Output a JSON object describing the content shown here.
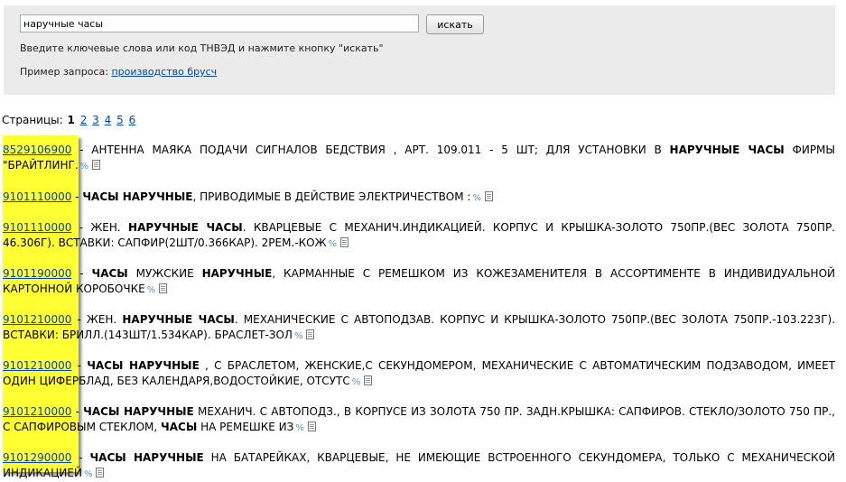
{
  "search": {
    "value": "наручные часы",
    "button_label": "искать",
    "hint": "Введите ключевые слова или код ТНВЭД и нажмите кнопку \"искать\"",
    "example_label": "Пример запроса:",
    "example_link": "производство брусч"
  },
  "pager": {
    "label": "Страницы:",
    "current": "1",
    "pages": [
      "2",
      "3",
      "4",
      "5",
      "6"
    ]
  },
  "results": [
    {
      "code": "8529106900",
      "segments": [
        {
          "t": " - АНТЕННА МАЯКА ПОДАЧИ СИГНАЛОВ БЕДСТВИЯ , АРТ. 109.011 - 5 ШТ; ДЛЯ УСТАНОВКИ В ",
          "b": false
        },
        {
          "t": "НАРУЧНЫЕ ЧАСЫ",
          "b": true
        },
        {
          "t": " ФИРМЫ \"БРАЙТЛИНГ.",
          "b": false
        }
      ]
    },
    {
      "code": "9101110000",
      "segments": [
        {
          "t": " - ",
          "b": false
        },
        {
          "t": "ЧАСЫ НАРУЧНЫЕ",
          "b": true
        },
        {
          "t": ", ПРИВОДИМЫЕ В ДЕЙСТВИЕ ЭЛЕКТРИЧЕСТВОМ :",
          "b": false
        }
      ]
    },
    {
      "code": "9101110000",
      "segments": [
        {
          "t": " - ЖЕН. ",
          "b": false
        },
        {
          "t": "НАРУЧНЫЕ ЧАСЫ",
          "b": true
        },
        {
          "t": ". КВАРЦЕВЫЕ С МЕХАНИЧ.ИНДИКАЦИЕЙ. КОРПУС И КРЫШКА-ЗОЛОТО 750ПР.(ВЕС ЗОЛОТА 750ПР. 46.306Г). ВСТАВКИ: САПФИР(2ШТ/0.366КАР). 2РЕМ.-КОЖ",
          "b": false
        }
      ]
    },
    {
      "code": "9101190000",
      "segments": [
        {
          "t": " - ",
          "b": false
        },
        {
          "t": "ЧАСЫ",
          "b": true
        },
        {
          "t": " МУЖСКИЕ ",
          "b": false
        },
        {
          "t": "НАРУЧНЫЕ",
          "b": true
        },
        {
          "t": ", КАРМАННЫЕ С РЕМЕШКОМ ИЗ КОЖЕЗАМЕНИТЕЛЯ В АССОРТИМЕНТЕ В ИНДИВИДУАЛЬНОЙ КАРТОННОЙ КОРОБОЧКЕ",
          "b": false
        }
      ]
    },
    {
      "code": "9101210000",
      "segments": [
        {
          "t": " - ЖЕН. ",
          "b": false
        },
        {
          "t": "НАРУЧНЫЕ ЧАСЫ",
          "b": true
        },
        {
          "t": ". МЕХАНИЧЕСКИЕ С АВТОПОДЗАВ. КОРПУС И КРЫШКА-ЗОЛОТО 750ПР.(ВЕС ЗОЛОТА 750ПР.-103.223Г). ВСТАВКИ: БРИЛЛ.(143ШТ/1.534КАР). БРАСЛЕТ-ЗОЛ",
          "b": false
        }
      ]
    },
    {
      "code": "9101210000",
      "segments": [
        {
          "t": " - ",
          "b": false
        },
        {
          "t": "ЧАСЫ НАРУЧНЫЕ",
          "b": true
        },
        {
          "t": " , С БРАСЛЕТОМ, ЖЕНСКИЕ,С СЕКУНДОМЕРОМ, МЕХАНИЧЕСКИЕ С АВТОМАТИЧЕСКИМ ПОДЗАВОДОМ, ИМЕЕТ ОДИН ЦИФЕРБЛАД, БЕЗ КАЛЕНДАРЯ,ВОДОСТОЙКИЕ, ОТСУТС",
          "b": false
        }
      ]
    },
    {
      "code": "9101210000",
      "segments": [
        {
          "t": " - ",
          "b": false
        },
        {
          "t": "ЧАСЫ НАРУЧНЫЕ",
          "b": true
        },
        {
          "t": " МЕХАНИЧ. С АВТОПОДЗ., В КОРПУСЕ ИЗ ЗОЛОТА 750 ПР. ЗАДН.КРЫШКА: САПФИРОВ. СТЕКЛО/ЗОЛОТО 750 ПР., С САПФИРОВЫМ СТЕКЛОМ, ",
          "b": false
        },
        {
          "t": "ЧАСЫ",
          "b": true
        },
        {
          "t": " НА РЕМЕШКЕ ИЗ",
          "b": false
        }
      ]
    },
    {
      "code": "9101290000",
      "segments": [
        {
          "t": " - ",
          "b": false
        },
        {
          "t": "ЧАСЫ НАРУЧНЫЕ",
          "b": true
        },
        {
          "t": " НА БАТАРЕЙКАХ, КВАРЦЕВЫЕ, НЕ ИМЕЮЩИЕ ВСТРОЕННОГО СЕКУНДОМЕРА, ТОЛЬКО С МЕХАНИЧЕСКОЙ ИНДИКАЦИЕЙ",
          "b": false
        }
      ]
    }
  ],
  "marker_symbol": "%",
  "icons": {
    "doc": "document-icon"
  },
  "colors": {
    "highlight": "#ffff33",
    "link": "#0645ad",
    "panel": "#ebebeb"
  }
}
